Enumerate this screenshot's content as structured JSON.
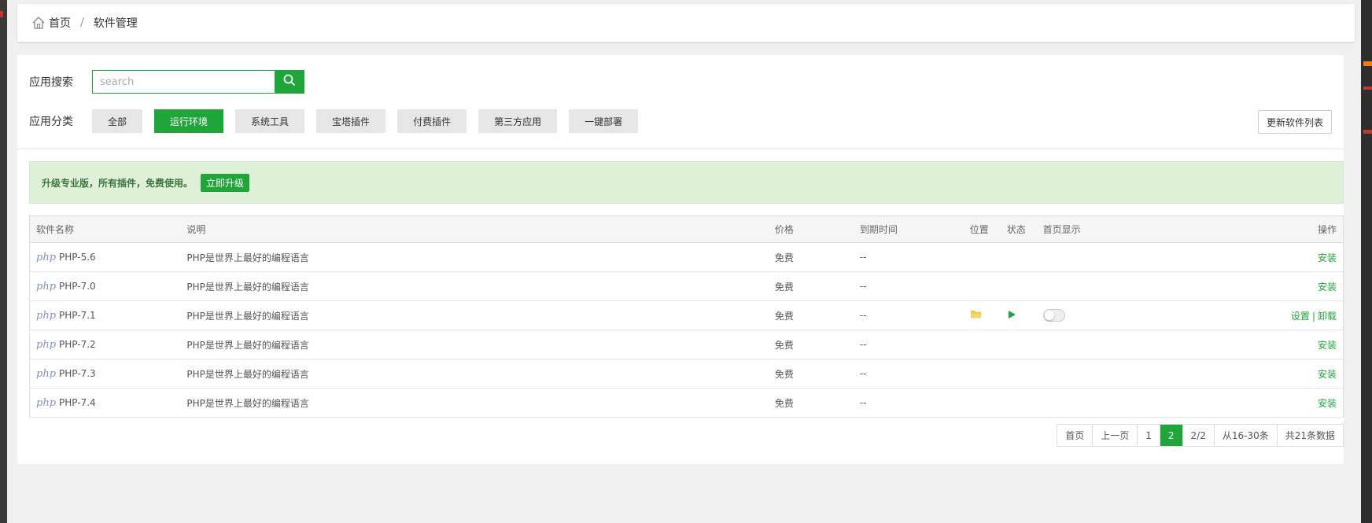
{
  "breadcrumb": {
    "home": "首页",
    "separator": "/",
    "current": "软件管理"
  },
  "search": {
    "label": "应用搜索",
    "placeholder": "search"
  },
  "category": {
    "label": "应用分类",
    "items": [
      "全部",
      "运行环境",
      "系统工具",
      "宝塔插件",
      "付费插件",
      "第三方应用",
      "一键部署"
    ],
    "active": "运行环境"
  },
  "refresh_label": "更新软件列表",
  "alert": {
    "text": "升级专业版，所有插件，免费使用。",
    "button": "立即升级"
  },
  "table": {
    "headers": [
      "软件名称",
      "说明",
      "价格",
      "到期时间",
      "位置",
      "状态",
      "首页显示",
      "操作"
    ],
    "rows": [
      {
        "logo": "php",
        "name": "PHP-5.6",
        "desc": "PHP是世界上最好的编程语言",
        "price": "免费",
        "expire": "--",
        "installed": false,
        "action": "安装"
      },
      {
        "logo": "php",
        "name": "PHP-7.0",
        "desc": "PHP是世界上最好的编程语言",
        "price": "免费",
        "expire": "--",
        "installed": false,
        "action": "安装"
      },
      {
        "logo": "php",
        "name": "PHP-7.1",
        "desc": "PHP是世界上最好的编程语言",
        "price": "免费",
        "expire": "--",
        "installed": true,
        "settings": "设置",
        "uninstall": "卸载",
        "sep": "|"
      },
      {
        "logo": "php",
        "name": "PHP-7.2",
        "desc": "PHP是世界上最好的编程语言",
        "price": "免费",
        "expire": "--",
        "installed": false,
        "action": "安装"
      },
      {
        "logo": "php",
        "name": "PHP-7.3",
        "desc": "PHP是世界上最好的编程语言",
        "price": "免费",
        "expire": "--",
        "installed": false,
        "action": "安装"
      },
      {
        "logo": "php",
        "name": "PHP-7.4",
        "desc": "PHP是世界上最好的编程语言",
        "price": "免费",
        "expire": "--",
        "installed": false,
        "action": "安装"
      }
    ]
  },
  "pagination": {
    "first": "首页",
    "prev": "上一页",
    "pages": [
      "1",
      "2"
    ],
    "current": "2",
    "page_info": "2/2",
    "range": "从16-30条",
    "total": "共21条数据"
  },
  "colors": {
    "accent": "#20a53a",
    "alert_bg": "#dff0d8",
    "alert_text": "#3c763d",
    "folder": "#e8c84a"
  },
  "icons": {
    "home": "home-icon",
    "search": "search-icon",
    "folder": "folder-icon",
    "play": "play-icon"
  }
}
